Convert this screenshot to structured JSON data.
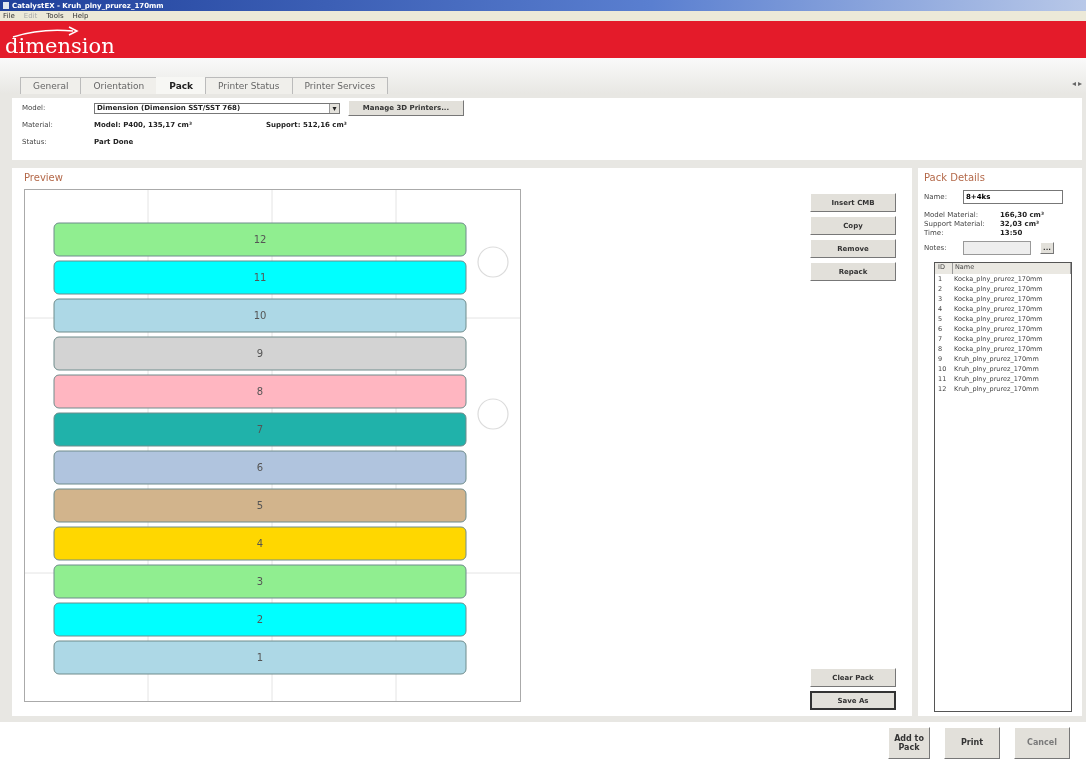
{
  "window": {
    "title": "CatalystEX - Kruh_plny_prurez_170mm"
  },
  "menu": [
    {
      "label": "File",
      "disabled": false
    },
    {
      "label": "Edit",
      "disabled": true
    },
    {
      "label": "Tools",
      "disabled": false
    },
    {
      "label": "Help",
      "disabled": false
    }
  ],
  "brand": {
    "logo": "dimension"
  },
  "tabs": [
    {
      "label": "General",
      "selected": false
    },
    {
      "label": "Orientation",
      "selected": false
    },
    {
      "label": "Pack",
      "selected": true
    },
    {
      "label": "Printer Status",
      "selected": false
    },
    {
      "label": "Printer Services",
      "selected": false
    }
  ],
  "tab_scroll": [
    "◂",
    "▸"
  ],
  "printer": {
    "model_label": "Model:",
    "model_value": "Dimension (Dimension SST/SST 768)",
    "dropdown_arrow": "▾",
    "manage_button": "Manage 3D Printers...",
    "material_label": "Material:",
    "model_material": "Model: P400, 135,17 cm³",
    "support_material": "Support: 512,16 cm³",
    "status_label": "Status:",
    "status_value": "Part Done"
  },
  "preview": {
    "title": "Preview",
    "parts": [
      {
        "label": "12",
        "color": "#90ee90"
      },
      {
        "label": "11",
        "color": "#00ffff"
      },
      {
        "label": "10",
        "color": "#add8e6"
      },
      {
        "label": "9",
        "color": "#d3d3d3"
      },
      {
        "label": "8",
        "color": "#ffb6c1"
      },
      {
        "label": "7",
        "color": "#20b2aa"
      },
      {
        "label": "6",
        "color": "#b0c4de"
      },
      {
        "label": "5",
        "color": "#d2b48c"
      },
      {
        "label": "4",
        "color": "#ffd700"
      },
      {
        "label": "3",
        "color": "#90ee90"
      },
      {
        "label": "2",
        "color": "#00ffff"
      },
      {
        "label": "1",
        "color": "#add8e6"
      }
    ],
    "top_buttons": [
      "Insert CMB",
      "Copy",
      "Remove",
      "Repack"
    ],
    "bottom_buttons": [
      {
        "label": "Clear Pack",
        "focused": false
      },
      {
        "label": "Save As",
        "focused": true
      }
    ]
  },
  "pack_details": {
    "title": "Pack Details",
    "name_label": "Name:",
    "name_value": "8+4ks",
    "model_material_label": "Model Material:",
    "model_material_value": "166,30 cm³",
    "support_material_label": "Support Material:",
    "support_material_value": "32,03 cm³",
    "time_label": "Time:",
    "time_value": "13:50",
    "notes_label": "Notes:",
    "notes_button": "...",
    "columns": [
      "ID",
      "Name"
    ],
    "rows": [
      {
        "id": "1",
        "name": "Kocka_plny_prurez_170mm"
      },
      {
        "id": "2",
        "name": "Kocka_plny_prurez_170mm"
      },
      {
        "id": "3",
        "name": "Kocka_plny_prurez_170mm"
      },
      {
        "id": "4",
        "name": "Kocka_plny_prurez_170mm"
      },
      {
        "id": "5",
        "name": "Kocka_plny_prurez_170mm"
      },
      {
        "id": "6",
        "name": "Kocka_plny_prurez_170mm"
      },
      {
        "id": "7",
        "name": "Kocka_plny_prurez_170mm"
      },
      {
        "id": "8",
        "name": "Kocka_plny_prurez_170mm"
      },
      {
        "id": "9",
        "name": "Kruh_plny_prurez_170mm"
      },
      {
        "id": "10",
        "name": "Kruh_plny_prurez_170mm"
      },
      {
        "id": "11",
        "name": "Kruh_plny_prurez_170mm"
      },
      {
        "id": "12",
        "name": "Kruh_plny_prurez_170mm"
      }
    ]
  },
  "footer_buttons": [
    {
      "label": "Add to Pack",
      "disabled": false
    },
    {
      "label": "Print",
      "disabled": false
    },
    {
      "label": "Cancel",
      "disabled": true
    }
  ]
}
